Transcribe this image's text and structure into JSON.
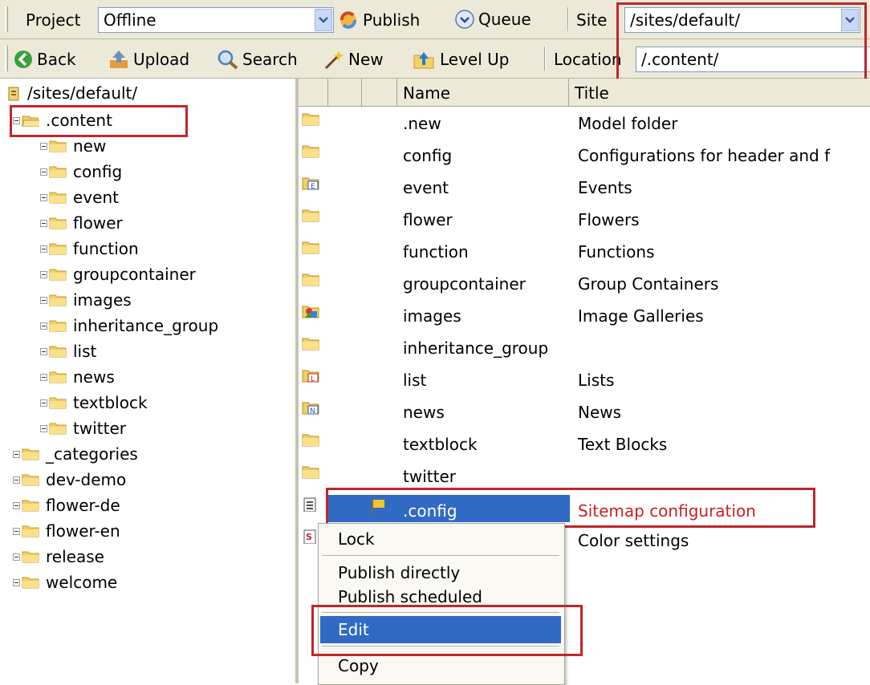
{
  "toolbar1": {
    "project_label": "Project",
    "project_value": "Offline",
    "publish_label": "Publish",
    "queue_label": "Queue",
    "site_label": "Site",
    "site_value": "/sites/default/"
  },
  "toolbar2": {
    "back_label": "Back",
    "upload_label": "Upload",
    "search_label": "Search",
    "new_label": "New",
    "levelup_label": "Level Up",
    "location_label": "Location",
    "location_value": "/.content/"
  },
  "tree": {
    "root": "/sites/default/",
    "content": ".content",
    "children": [
      "new",
      "config",
      "event",
      "flower",
      "function",
      "groupcontainer",
      "images",
      "inheritance_group",
      "list",
      "news",
      "textblock",
      "twitter"
    ],
    "siblings": [
      "_categories",
      "dev-demo",
      "flower-de",
      "flower-en",
      "release",
      "welcome"
    ]
  },
  "list": {
    "headers": {
      "name": "Name",
      "title": "Title"
    },
    "rows": [
      {
        "name": ".new",
        "title": "Model folder",
        "icon": "folder-icon"
      },
      {
        "name": "config",
        "title": "Configurations for header and f",
        "icon": "folder-icon"
      },
      {
        "name": "event",
        "title": "Events",
        "icon": "event-folder-icon"
      },
      {
        "name": "flower",
        "title": "Flowers",
        "icon": "folder-icon"
      },
      {
        "name": "function",
        "title": "Functions",
        "icon": "folder-icon"
      },
      {
        "name": "groupcontainer",
        "title": "Group Containers",
        "icon": "folder-icon"
      },
      {
        "name": "images",
        "title": "Image Galleries",
        "icon": "gallery-folder-icon"
      },
      {
        "name": "inheritance_group",
        "title": "",
        "icon": "folder-icon"
      },
      {
        "name": "list",
        "title": "Lists",
        "icon": "list-folder-icon"
      },
      {
        "name": "news",
        "title": "News",
        "icon": "news-folder-icon"
      },
      {
        "name": "textblock",
        "title": "Text Blocks",
        "icon": "folder-icon"
      },
      {
        "name": "twitter",
        "title": "",
        "icon": "folder-icon"
      },
      {
        "name": ".config",
        "title": "Sitemap configuration",
        "icon": "sitemap-file-icon",
        "selected": true
      },
      {
        "name": "",
        "title": "Color settings",
        "icon": "color-file-icon"
      }
    ]
  },
  "context_menu": {
    "items": [
      "Lock",
      "Publish directly",
      "Publish scheduled",
      "Edit",
      "Copy"
    ],
    "highlighted": "Edit"
  },
  "colors": {
    "selection": "#316ac5",
    "highlight_box": "#c0262c",
    "selected_title": "#cc1f1f"
  }
}
